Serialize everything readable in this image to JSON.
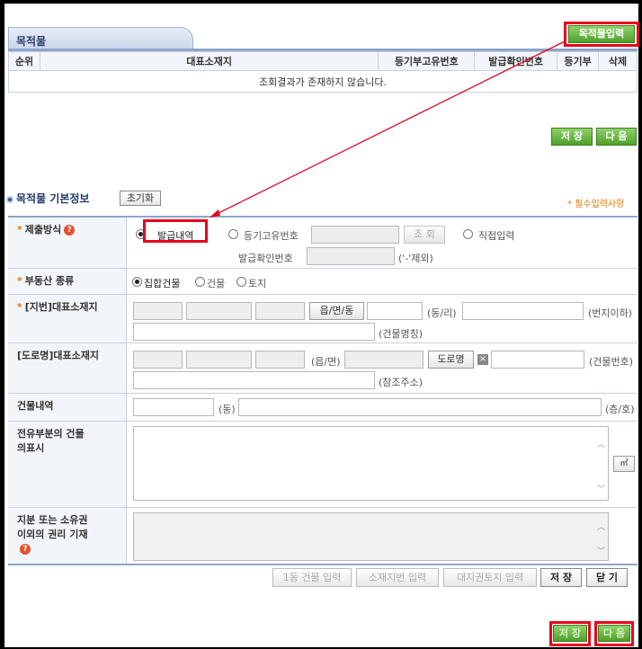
{
  "tab": {
    "title": "목적물"
  },
  "top_button": "목적물입력",
  "list": {
    "headers": [
      "순위",
      "대표소재지",
      "등기부고유번호",
      "발급확인번호",
      "등기부",
      "삭제"
    ],
    "empty_message": "조회결과가 존재하지 않습니다."
  },
  "mid_buttons": {
    "save": "저 장",
    "next": "다 음"
  },
  "section": {
    "title": "목적물 기본정보",
    "reset": "초기화",
    "required_note": "* 필수입력사항"
  },
  "form": {
    "submit_method": {
      "label": "제출방식",
      "opt_issue": "발급내역",
      "opt_regno": "등기고유번호",
      "lookup": "조 회",
      "opt_direct": "직접입력",
      "issue_confirm_label": "발급확인번호",
      "hint": "('-'제외)"
    },
    "property_type": {
      "label": "부동산 종류",
      "options": [
        "집합건물",
        "건물",
        "토지"
      ]
    },
    "lot_address": {
      "label": "[지번]대표소재지",
      "btn": "읍/면/동",
      "dongri": "(동/리)",
      "lotno": "(번지이하)",
      "bldg": "(건물명칭)"
    },
    "road_address": {
      "label": "[도로명]대표소재지",
      "eupmyeon": "(읍/면)",
      "btn": "도로명",
      "bldgno": "(건물번호)",
      "ref": "(참조주소)"
    },
    "building": {
      "label": "건물내역",
      "dong": "(동)",
      "floor": "(층/호)"
    },
    "exclusive": {
      "label": "전유부분의 건물의표시",
      "unit": "㎡"
    },
    "share": {
      "label": "지분 또는 소유권이외의 권리 기재"
    }
  },
  "bottom_buttons": [
    "1동 건물 입력",
    "소재지번 입력",
    "대지권토지 입력",
    "저 장",
    "닫 기"
  ],
  "final_buttons": {
    "save": "저 장",
    "next": "다 음"
  }
}
